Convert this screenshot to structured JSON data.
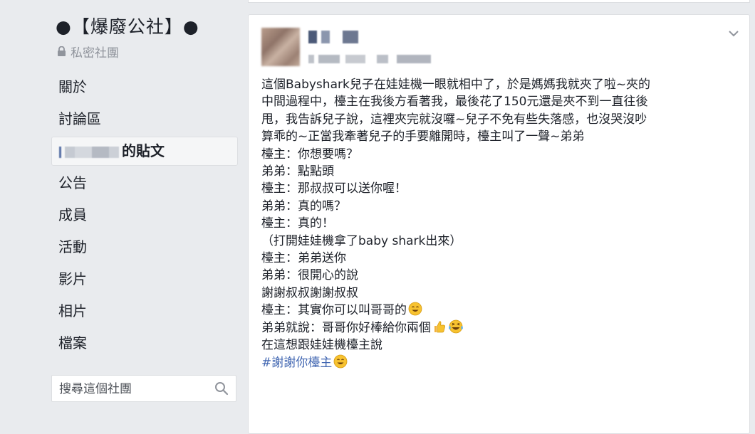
{
  "group": {
    "title": "●【爆廢公社】●",
    "privacy_label": "私密社團"
  },
  "nav": {
    "items": [
      {
        "label": "關於"
      },
      {
        "label": "討論區"
      },
      {
        "label": "的貼文"
      },
      {
        "label": "公告"
      },
      {
        "label": "成員"
      },
      {
        "label": "活動"
      },
      {
        "label": "影片"
      },
      {
        "label": "相片"
      },
      {
        "label": "檔案"
      }
    ]
  },
  "search": {
    "placeholder": "搜尋這個社團"
  },
  "post": {
    "lines": [
      "這個Babyshark兒子在娃娃機一眼就相中了，於是媽媽我就夾了啦~夾的",
      "中間過程中，檯主在我後方看著我，最後花了150元還是夾不到一直往後",
      "甩，我告訴兒子說，這裡夾完就沒囉~兒子不免有些失落感，也沒哭沒吵",
      "算乖的~正當我牽著兒子的手要離開時，檯主叫了一聲~弟弟",
      "檯主：你想要嗎？",
      "弟弟：點點頭",
      "檯主：那叔叔可以送你喔！",
      "弟弟：真的嗎？",
      "檯主：真的！",
      "（打開娃娃機拿了baby shark出來）",
      "檯主：弟弟送你",
      "弟弟：很開心的說",
      "謝謝叔叔謝謝叔叔",
      "檯主：其實你可以叫哥哥的",
      "弟弟就說：哥哥你好棒給你兩個",
      "在這想跟娃娃機檯主說"
    ],
    "hashtag": "#謝謝你檯主"
  },
  "icons": {
    "lock": "lock-icon",
    "search": "search-icon",
    "chevron": "chevron-down-icon",
    "smile_emoji": "smiling-emoji-icon",
    "thumbs_up": "thumbs-up-icon",
    "laugh_emoji": "tears-of-joy-emoji-icon"
  },
  "colors": {
    "page_bg": "#e9ebee",
    "text": "#1d2129",
    "muted": "#90949c",
    "link": "#4267b2",
    "emoji_yellow": "#f7c230"
  }
}
